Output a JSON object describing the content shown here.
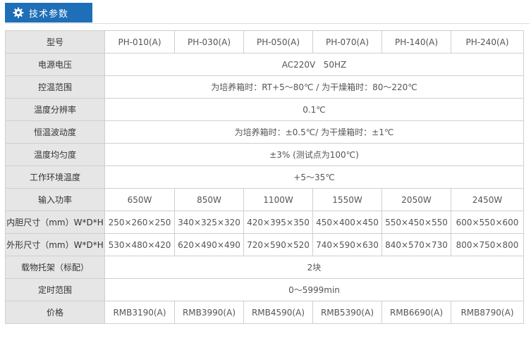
{
  "header": {
    "title": "技术参数",
    "icon": "gear-icon"
  },
  "colors": {
    "header_bg": "#1e6fb8",
    "label_bg": "#e6e6e6",
    "border": "#cfcfcf"
  },
  "models": [
    "PH-010(A)",
    "PH-030(A)",
    "PH-050(A)",
    "PH-070(A)",
    "PH-140(A)",
    "PH-240(A)"
  ],
  "rows": [
    {
      "label": "型号"
    },
    {
      "label": "电源电压",
      "value": "AC220V   50HZ"
    },
    {
      "label": "控温范围",
      "value": "为培养箱时：RT+5～80℃ / 为干燥箱时：80～220℃"
    },
    {
      "label": "温度分辨率",
      "value": "0.1℃"
    },
    {
      "label": "恒温波动度",
      "value": "为培养箱时：±0.5℃/ 为干燥箱时：±1℃"
    },
    {
      "label": "温度均匀度",
      "value": "±3% (测试点为100℃)"
    },
    {
      "label": "工作环境温度",
      "value": "+5～35℃"
    },
    {
      "label": "输入功率",
      "values": [
        "650W",
        "850W",
        "1100W",
        "1550W",
        "2050W",
        "2450W"
      ]
    },
    {
      "label": "内胆尺寸（mm）W*D*H",
      "values": [
        "250×260×250",
        "340×325×320",
        "420×395×350",
        "450×400×450",
        "550×450×550",
        "600×550×600"
      ]
    },
    {
      "label": "外形尺寸（mm）W*D*H",
      "values": [
        "530×480×420",
        "620×490×490",
        "720×590×520",
        "740×590×630",
        "840×570×730",
        "800×750×800"
      ]
    },
    {
      "label": "载物托架（标配）",
      "value": "2块"
    },
    {
      "label": "定时范围",
      "value": "0～5999min"
    },
    {
      "label": "价格",
      "values": [
        "RMB3190(A)",
        "RMB3990(A)",
        "RMB4590(A)",
        "RMB5390(A)",
        "RMB6690(A)",
        "RMB8790(A)"
      ]
    }
  ]
}
